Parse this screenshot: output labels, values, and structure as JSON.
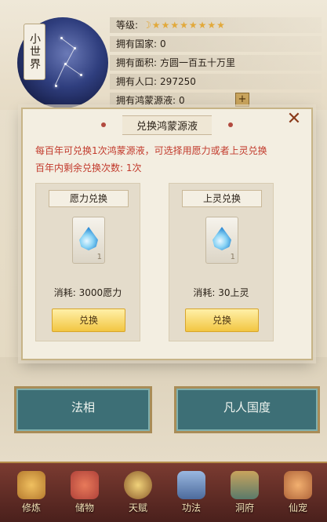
{
  "world": {
    "tag": "小世界",
    "rows": [
      {
        "label": "等级:",
        "value": "",
        "stars": "☽★★★★★★★★"
      },
      {
        "label": "拥有国家:",
        "value": "0"
      },
      {
        "label": "拥有面积:",
        "value": "方圆一百五十万里"
      },
      {
        "label": "拥有人口:",
        "value": "297250"
      },
      {
        "label": "拥有鸿蒙源液:",
        "value": "0"
      }
    ],
    "plus": "+"
  },
  "modal": {
    "title": "兑换鸿蒙源液",
    "close": "✕",
    "desc1": "每百年可兑换1次鸿蒙源液，可选择用愿力或者上灵兑换",
    "desc2": "百年内剩余兑换次数: 1次",
    "cards": [
      {
        "header": "愿力兑换",
        "count": "1",
        "cost": "消耗: 3000愿力",
        "button": "兑换"
      },
      {
        "header": "上灵兑换",
        "count": "1",
        "cost": "消耗: 30上灵",
        "button": "兑换"
      }
    ]
  },
  "tabs": [
    "法相",
    "凡人国度"
  ],
  "nav": [
    {
      "label": "修炼",
      "color": "#b57a2e"
    },
    {
      "label": "储物",
      "color": "#b0423a"
    },
    {
      "label": "天赋",
      "color": "#8a5a2a"
    },
    {
      "label": "功法",
      "color": "#4c6a9c"
    },
    {
      "label": "洞府",
      "color": "#5a7a6a"
    },
    {
      "label": "仙宠",
      "color": "#b0653a"
    }
  ]
}
